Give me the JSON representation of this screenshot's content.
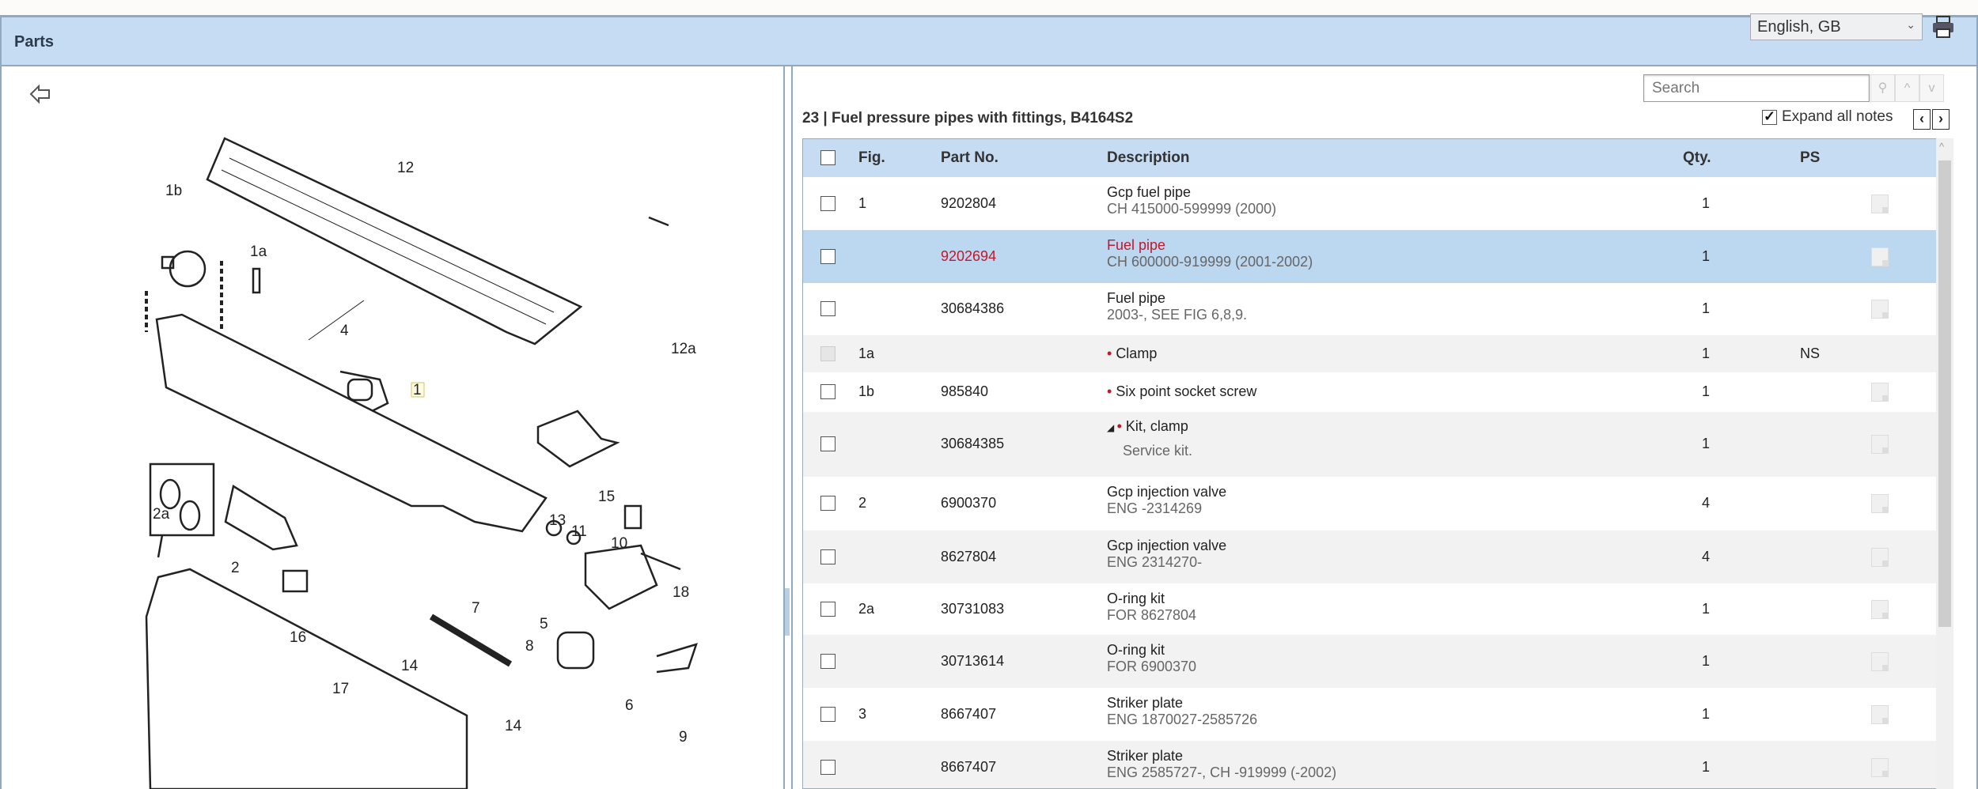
{
  "header": {
    "title": "Parts",
    "language": "English, GB"
  },
  "diagram": {
    "labels": [
      "12",
      "1b",
      "1a",
      "4",
      "12a",
      "1",
      "15",
      "2a",
      "2",
      "13",
      "11",
      "10",
      "18",
      "5",
      "7",
      "8",
      "16",
      "14",
      "14",
      "6",
      "9",
      "17"
    ]
  },
  "panel": {
    "title": "23  |  Fuel pressure pipes with fittings, B4164S2",
    "search_placeholder": "Search",
    "expand_all_notes": "Expand all notes",
    "expand_checked": true
  },
  "table": {
    "columns": {
      "fig": "Fig.",
      "part": "Part No.",
      "desc": "Description",
      "qty": "Qty.",
      "ps": "PS"
    },
    "rows": [
      {
        "fig": "1",
        "part": "9202804",
        "desc": "Gcp fuel pipe",
        "sub": "CH 415000-599999 (2000)",
        "qty": "1",
        "ps": ""
      },
      {
        "fig": "",
        "part": "9202694",
        "desc": "Fuel pipe",
        "sub": "CH 600000-919999 (2001-2002)",
        "qty": "1",
        "ps": "",
        "selected": true
      },
      {
        "fig": "",
        "part": "30684386",
        "desc": "Fuel pipe",
        "sub": "2003-, SEE FIG 6,8,9.",
        "qty": "1",
        "ps": ""
      },
      {
        "fig": "1a",
        "part": "",
        "desc": "Clamp",
        "sub": "",
        "qty": "1",
        "ps": "NS",
        "bullet": true
      },
      {
        "fig": "1b",
        "part": "985840",
        "desc": "Six point socket screw",
        "sub": "",
        "qty": "1",
        "ps": "",
        "bullet": true
      },
      {
        "fig": "",
        "part": "30684385",
        "desc": "Kit, clamp",
        "sub": "Service kit.",
        "qty": "1",
        "ps": "",
        "bullet": true,
        "kit": true
      },
      {
        "fig": "2",
        "part": "6900370",
        "desc": "Gcp injection valve",
        "sub": "ENG -2314269",
        "qty": "4",
        "ps": ""
      },
      {
        "fig": "",
        "part": "8627804",
        "desc": "Gcp injection valve",
        "sub": "ENG 2314270-",
        "qty": "4",
        "ps": ""
      },
      {
        "fig": "2a",
        "part": "30731083",
        "desc": "O-ring kit",
        "sub": "FOR 8627804",
        "qty": "1",
        "ps": ""
      },
      {
        "fig": "",
        "part": "30713614",
        "desc": "O-ring kit",
        "sub": "FOR 6900370",
        "qty": "1",
        "ps": ""
      },
      {
        "fig": "3",
        "part": "8667407",
        "desc": "Striker plate",
        "sub": "ENG 1870027-2585726",
        "qty": "1",
        "ps": ""
      },
      {
        "fig": "",
        "part": "8667407",
        "desc": "Striker plate",
        "sub": "ENG 2585727-, CH -919999 (-2002)",
        "qty": "1",
        "ps": ""
      }
    ]
  }
}
